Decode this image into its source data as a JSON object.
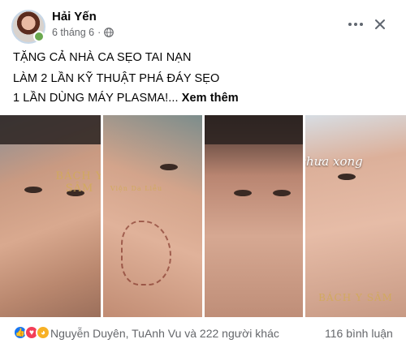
{
  "post": {
    "author": "Hải Yến",
    "date": "6 tháng 6",
    "dot": "·",
    "lines": [
      "TẶNG CẢ NHÀ CA SẸO TAI NẠN",
      "LÀM 2 LẦN KỸ THUẬT PHÁ ĐÁY SẸO",
      "1 LẦN  DÙNG MÁY PLASMA!..."
    ],
    "see_more": "Xem thêm",
    "photos": {
      "brand": "BÁCH Y SÂM",
      "brand_sub": "Viện Da Liễu",
      "brand_2": "BÁCH Y SÂM",
      "overlay": "Điều trị chưa xong"
    },
    "reactions": {
      "icons": [
        "like-icon",
        "love-icon",
        "wow-icon"
      ],
      "reactors": "Nguyễn Duyên, TuAnh Vu và 222 người khác",
      "comments": "116 bình luận"
    }
  },
  "colors": {
    "text": "#050505",
    "secondary": "#65676b",
    "like": "#1877f2",
    "love": "#f33e58",
    "wow": "#f7b125"
  }
}
